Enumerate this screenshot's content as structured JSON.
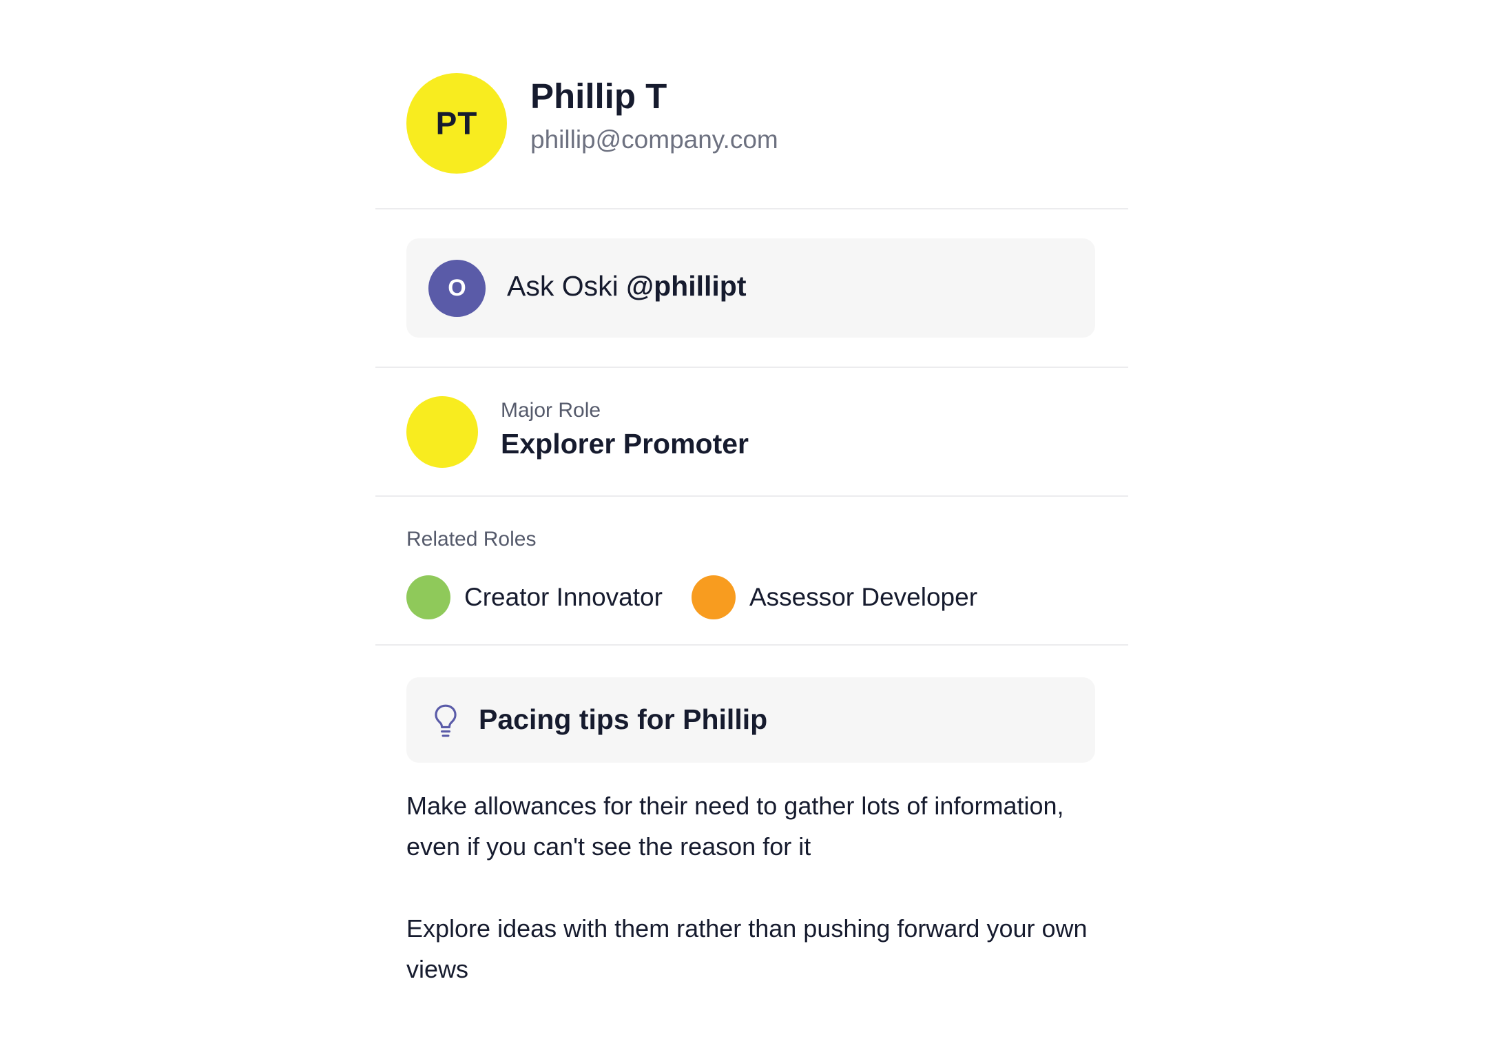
{
  "profile": {
    "initials": "PT",
    "name": "Phillip T",
    "email": "phillip@company.com",
    "avatar_color": "#f8ec1f"
  },
  "ask": {
    "avatar_letter": "O",
    "prefix": "Ask Oski",
    "handle": "@phillipt",
    "avatar_color": "#5a5ba8"
  },
  "major_role": {
    "label": "Major Role",
    "value": "Explorer Promoter",
    "color": "#f8ec1f"
  },
  "related_roles": {
    "label": "Related Roles",
    "items": [
      {
        "name": "Creator Innovator",
        "color": "#8fc95a"
      },
      {
        "name": "Assessor Developer",
        "color": "#f89c1f"
      }
    ]
  },
  "tips": {
    "icon": "lightbulb-icon",
    "title": "Pacing tips for Phillip",
    "items": [
      "Make allowances for their need to gather lots of information, even if you can't see the reason for it",
      "Explore ideas with them rather than pushing forward your own views"
    ]
  }
}
